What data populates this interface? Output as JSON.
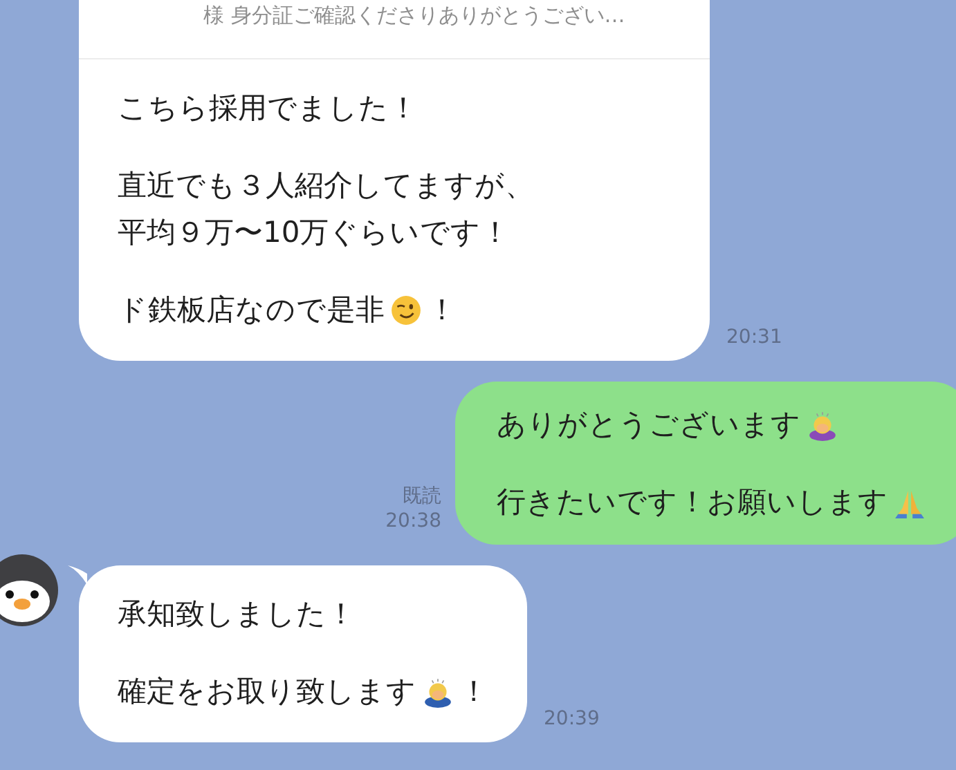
{
  "messages": [
    {
      "kind": "incoming",
      "avatar": false,
      "quote": "様 身分証ご確認くださりありがとうござい…",
      "time": "20:31",
      "paragraphs": [
        [
          {
            "parts": [
              {
                "kind": "text",
                "text": "こちら採用でました！"
              }
            ]
          }
        ],
        [
          {
            "parts": [
              {
                "kind": "text",
                "text": "直近でも３人紹介してますが、"
              }
            ]
          },
          {
            "parts": [
              {
                "kind": "text",
                "text": "平均９万〜10万ぐらいです！"
              }
            ]
          }
        ],
        [
          {
            "parts": [
              {
                "kind": "text",
                "text": "ド鉄板店なので是非"
              },
              {
                "kind": "wink"
              },
              {
                "kind": "text",
                "text": "！"
              }
            ]
          }
        ]
      ]
    },
    {
      "kind": "outgoing",
      "read": "既読",
      "time": "20:38",
      "paragraphs": [
        [
          {
            "parts": [
              {
                "kind": "text",
                "text": "ありがとうございます"
              },
              {
                "kind": "bow_woman"
              }
            ]
          }
        ],
        [
          {
            "parts": [
              {
                "kind": "text",
                "text": "行きたいです！お願いします"
              },
              {
                "kind": "pray"
              }
            ]
          }
        ]
      ]
    },
    {
      "kind": "incoming",
      "avatar": true,
      "time": "20:39",
      "paragraphs": [
        [
          {
            "parts": [
              {
                "kind": "text",
                "text": "承知致しました！"
              }
            ]
          }
        ],
        [
          {
            "parts": [
              {
                "kind": "text",
                "text": "確定をお取り致します"
              },
              {
                "kind": "bow_man"
              },
              {
                "kind": "text",
                "text": "！"
              }
            ]
          }
        ]
      ]
    }
  ]
}
